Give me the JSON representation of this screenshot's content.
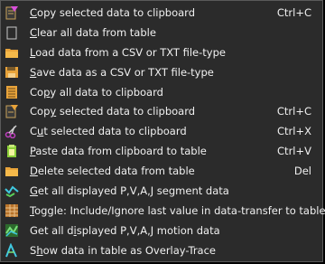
{
  "menu": {
    "items": [
      {
        "icon": "copy-selection-icon",
        "pre": "",
        "ul": "C",
        "post": "opy selected data to clipboard",
        "shortcut": "Ctrl+C"
      },
      {
        "icon": "clear-table-icon",
        "pre": "",
        "ul": "C",
        "post": "lear all data from table",
        "shortcut": ""
      },
      {
        "icon": "load-folder-icon",
        "pre": "",
        "ul": "L",
        "post": "oad data from a CSV or TXT file-type",
        "shortcut": ""
      },
      {
        "icon": "save-disk-icon",
        "pre": "",
        "ul": "S",
        "post": "ave data as a CSV or TXT file-type",
        "shortcut": ""
      },
      {
        "icon": "copy-all-icon",
        "pre": "Co",
        "ul": "p",
        "post": "y all data to clipboard",
        "shortcut": ""
      },
      {
        "icon": "copy-selected-icon",
        "pre": "Cop",
        "ul": "y",
        "post": " selected data to clipboard",
        "shortcut": "Ctrl+C"
      },
      {
        "icon": "cut-scissors-icon",
        "pre": "C",
        "ul": "u",
        "post": "t selected data to clipboard",
        "shortcut": "Ctrl+X"
      },
      {
        "icon": "paste-clipboard-icon",
        "pre": "",
        "ul": "P",
        "post": "aste data from clipboard to table",
        "shortcut": "Ctrl+V"
      },
      {
        "icon": "delete-folder-icon",
        "pre": "",
        "ul": "D",
        "post": "elete selected data from table",
        "shortcut": "Del"
      },
      {
        "icon": "segment-data-icon",
        "pre": "",
        "ul": "G",
        "post": "et all displayed P,V,A,J segment data",
        "shortcut": ""
      },
      {
        "icon": "toggle-grid-icon",
        "pre": "",
        "ul": "T",
        "post": "oggle: Include/Ignore last value in data-transfer to table",
        "shortcut": ""
      },
      {
        "icon": "motion-data-icon",
        "pre": "Get all d",
        "ul": "i",
        "post": "splayed P,V,A,J motion data",
        "shortcut": ""
      },
      {
        "icon": "overlay-trace-icon",
        "pre": "S",
        "ul": "h",
        "post": "ow data in table as Overlay-Trace",
        "shortcut": ""
      }
    ]
  }
}
